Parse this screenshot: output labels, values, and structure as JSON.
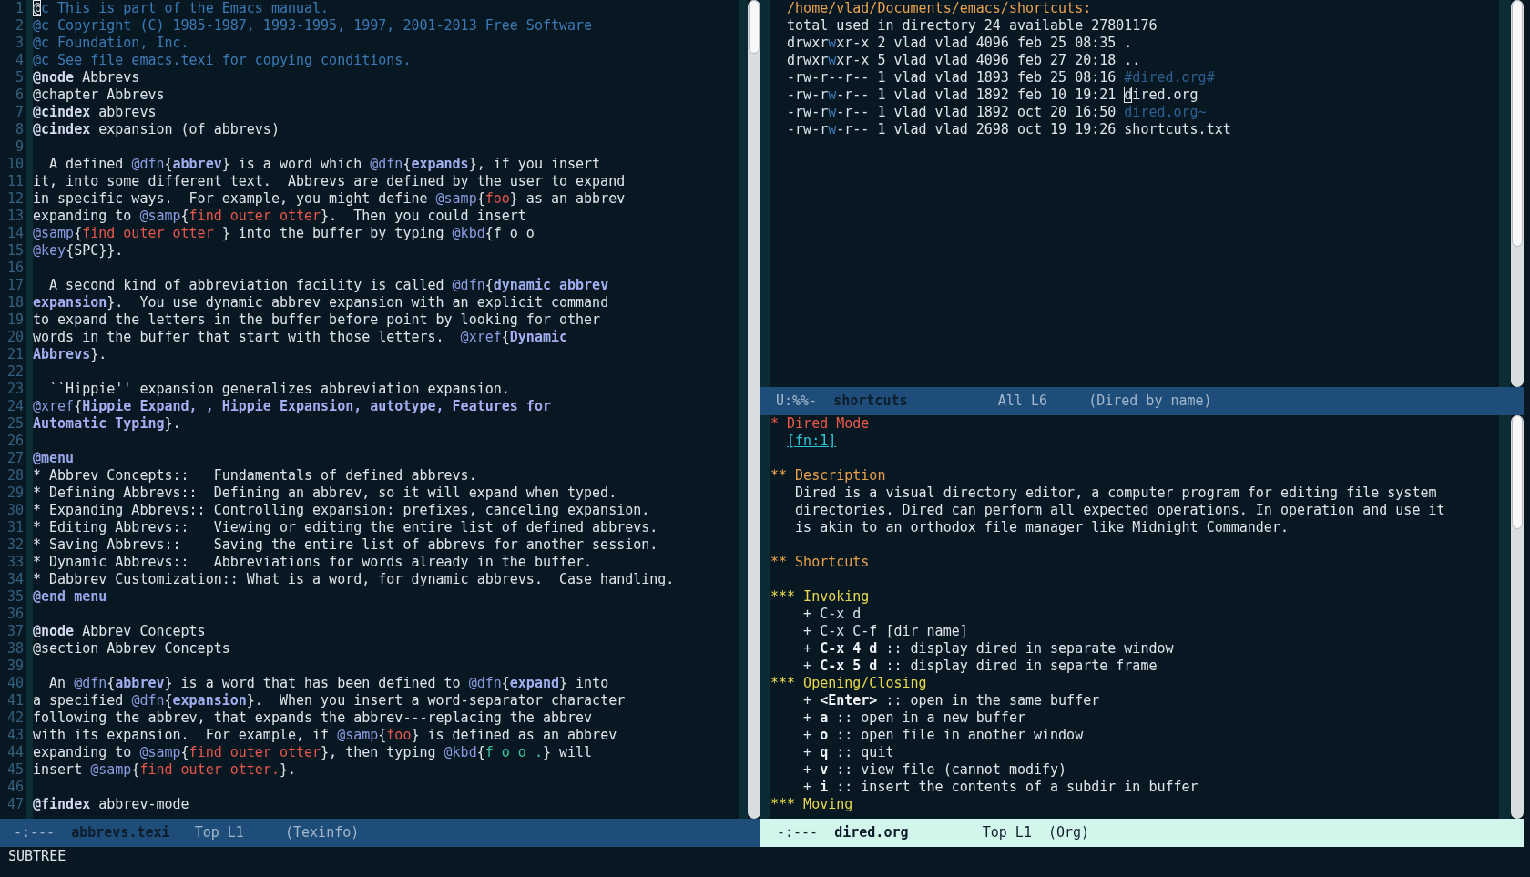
{
  "windows": [
    {
      "kind": "texinfo",
      "lines": [
        {
          "number": "1",
          "spans": [
            {
              "kind": "cursor",
              "text": "@"
            },
            {
              "kind": "comment",
              "text": "c This is part of the Emacs manual."
            }
          ]
        },
        {
          "number": "2",
          "spans": [
            {
              "kind": "comment",
              "text": "@c Copyright (C) 1985-1987, 1993-1995, 1997, 2001-2013 Free Software"
            }
          ]
        },
        {
          "number": "3",
          "spans": [
            {
              "kind": "comment",
              "text": "@c Foundation, Inc."
            }
          ]
        },
        {
          "number": "4",
          "spans": [
            {
              "kind": "comment",
              "text": "@c See file emacs.texi for copying conditions."
            }
          ]
        },
        {
          "number": "5",
          "spans": [
            {
              "kind": "keyword",
              "text": "@node"
            },
            {
              "kind": "text",
              "text": " Abbrevs"
            }
          ]
        },
        {
          "number": "6",
          "text": "@chapter Abbrevs"
        },
        {
          "number": "7",
          "spans": [
            {
              "kind": "keyword",
              "text": "@cindex"
            },
            {
              "kind": "text",
              "text": " abbrevs"
            }
          ]
        },
        {
          "number": "8",
          "spans": [
            {
              "kind": "keyword",
              "text": "@cindex"
            },
            {
              "kind": "text",
              "text": " expansion (of abbrevs)"
            }
          ]
        },
        {
          "number": "9"
        },
        {
          "number": "10",
          "spans": [
            {
              "kind": "text",
              "text": "  A defined "
            },
            {
              "kind": "command",
              "text": "@dfn"
            },
            {
              "kind": "text",
              "text": "{"
            },
            {
              "kind": "dfn",
              "text": "abbrev"
            },
            {
              "kind": "text",
              "text": "} is a word which "
            },
            {
              "kind": "command",
              "text": "@dfn"
            },
            {
              "kind": "text",
              "text": "{"
            },
            {
              "kind": "dfn",
              "text": "expands"
            },
            {
              "kind": "text",
              "text": "}, if you insert"
            }
          ]
        },
        {
          "number": "11",
          "text": "it, into some different text.  Abbrevs are defined by the user to expand"
        },
        {
          "number": "12",
          "spans": [
            {
              "kind": "text",
              "text": "in specific ways.  For example, you might define "
            },
            {
              "kind": "command",
              "text": "@samp"
            },
            {
              "kind": "text",
              "text": "{"
            },
            {
              "kind": "samp",
              "text": "foo"
            },
            {
              "kind": "text",
              "text": "} as an abbrev"
            }
          ]
        },
        {
          "number": "13",
          "spans": [
            {
              "kind": "text",
              "text": "expanding to "
            },
            {
              "kind": "command",
              "text": "@samp"
            },
            {
              "kind": "text",
              "text": "{"
            },
            {
              "kind": "samp",
              "text": "find outer otter"
            },
            {
              "kind": "text",
              "text": "}.  Then you could insert"
            }
          ]
        },
        {
          "number": "14",
          "spans": [
            {
              "kind": "command",
              "text": "@samp"
            },
            {
              "kind": "text",
              "text": "{"
            },
            {
              "kind": "samp",
              "text": "find outer otter "
            },
            {
              "kind": "text",
              "text": "} into the buffer by typing "
            },
            {
              "kind": "command",
              "text": "@kbd"
            },
            {
              "kind": "text",
              "text": "{f o o"
            }
          ]
        },
        {
          "number": "15",
          "spans": [
            {
              "kind": "command",
              "text": "@key"
            },
            {
              "kind": "text",
              "text": "{SPC}}."
            }
          ]
        },
        {
          "number": "16"
        },
        {
          "number": "17",
          "spans": [
            {
              "kind": "text",
              "text": "  A second kind of abbreviation facility is called "
            },
            {
              "kind": "command",
              "text": "@dfn"
            },
            {
              "kind": "text",
              "text": "{"
            },
            {
              "kind": "dfn",
              "text": "dynamic abbrev"
            }
          ]
        },
        {
          "number": "18",
          "spans": [
            {
              "kind": "dfn",
              "text": "expansion"
            },
            {
              "kind": "text",
              "text": "}.  You use dynamic abbrev expansion with an explicit command"
            }
          ]
        },
        {
          "number": "19",
          "text": "to expand the letters in the buffer before point by looking for other"
        },
        {
          "number": "20",
          "spans": [
            {
              "kind": "text",
              "text": "words in the buffer that start with those letters.  "
            },
            {
              "kind": "command",
              "text": "@xref"
            },
            {
              "kind": "text",
              "text": "{"
            },
            {
              "kind": "dfn",
              "text": "Dynamic"
            }
          ]
        },
        {
          "number": "21",
          "spans": [
            {
              "kind": "dfn",
              "text": "Abbrevs"
            },
            {
              "kind": "text",
              "text": "}."
            }
          ]
        },
        {
          "number": "22"
        },
        {
          "number": "23",
          "text": "  ``Hippie'' expansion generalizes abbreviation expansion."
        },
        {
          "number": "24",
          "spans": [
            {
              "kind": "command",
              "text": "@xref"
            },
            {
              "kind": "text",
              "text": "{"
            },
            {
              "kind": "dfn",
              "text": "Hippie Expand, , Hippie Expansion, autotype, Features for"
            }
          ]
        },
        {
          "number": "25",
          "spans": [
            {
              "kind": "dfn",
              "text": "Automatic Typing"
            },
            {
              "kind": "text",
              "text": "}."
            }
          ]
        },
        {
          "number": "26"
        },
        {
          "number": "27",
          "spans": [
            {
              "kind": "block",
              "text": "@menu"
            }
          ]
        },
        {
          "number": "28",
          "text": "* Abbrev Concepts::   Fundamentals of defined abbrevs."
        },
        {
          "number": "29",
          "text": "* Defining Abbrevs::  Defining an abbrev, so it will expand when typed."
        },
        {
          "number": "30",
          "text": "* Expanding Abbrevs:: Controlling expansion: prefixes, canceling expansion."
        },
        {
          "number": "31",
          "text": "* Editing Abbrevs::   Viewing or editing the entire list of defined abbrevs."
        },
        {
          "number": "32",
          "text": "* Saving Abbrevs::    Saving the entire list of abbrevs for another session."
        },
        {
          "number": "33",
          "text": "* Dynamic Abbrevs::   Abbreviations for words already in the buffer."
        },
        {
          "number": "34",
          "text": "* Dabbrev Customization:: What is a word, for dynamic abbrevs.  Case handling."
        },
        {
          "number": "35",
          "spans": [
            {
              "kind": "block",
              "text": "@end menu"
            }
          ]
        },
        {
          "number": "36"
        },
        {
          "number": "37",
          "spans": [
            {
              "kind": "keyword",
              "text": "@node"
            },
            {
              "kind": "text",
              "text": " Abbrev Concepts"
            }
          ]
        },
        {
          "number": "38",
          "text": "@section Abbrev Concepts"
        },
        {
          "number": "39"
        },
        {
          "number": "40",
          "spans": [
            {
              "kind": "text",
              "text": "  An "
            },
            {
              "kind": "command",
              "text": "@dfn"
            },
            {
              "kind": "text",
              "text": "{"
            },
            {
              "kind": "dfn",
              "text": "abbrev"
            },
            {
              "kind": "text",
              "text": "} is a word that has been defined to "
            },
            {
              "kind": "command",
              "text": "@dfn"
            },
            {
              "kind": "text",
              "text": "{"
            },
            {
              "kind": "dfn",
              "text": "expand"
            },
            {
              "kind": "text",
              "text": "} into"
            }
          ]
        },
        {
          "number": "41",
          "spans": [
            {
              "kind": "text",
              "text": "a specified "
            },
            {
              "kind": "command",
              "text": "@dfn"
            },
            {
              "kind": "text",
              "text": "{"
            },
            {
              "kind": "dfn",
              "text": "expansion"
            },
            {
              "kind": "text",
              "text": "}.  When you insert a word-separator character"
            }
          ]
        },
        {
          "number": "42",
          "text": "following the abbrev, that expands the abbrev---replacing the abbrev"
        },
        {
          "number": "43",
          "spans": [
            {
              "kind": "text",
              "text": "with its expansion.  For example, if "
            },
            {
              "kind": "command",
              "text": "@samp"
            },
            {
              "kind": "text",
              "text": "{"
            },
            {
              "kind": "samp",
              "text": "foo"
            },
            {
              "kind": "text",
              "text": "} is defined as an abbrev"
            }
          ]
        },
        {
          "number": "44",
          "spans": [
            {
              "kind": "text",
              "text": "expanding to "
            },
            {
              "kind": "command",
              "text": "@samp"
            },
            {
              "kind": "text",
              "text": "{"
            },
            {
              "kind": "samp",
              "text": "find outer otter"
            },
            {
              "kind": "text",
              "text": "}, then typing "
            },
            {
              "kind": "command",
              "text": "@kbd"
            },
            {
              "kind": "text",
              "text": "{"
            },
            {
              "kind": "kbd",
              "text": "f o o ."
            },
            {
              "kind": "text",
              "text": "} will"
            }
          ]
        },
        {
          "number": "45",
          "spans": [
            {
              "kind": "text",
              "text": "insert "
            },
            {
              "kind": "command",
              "text": "@samp"
            },
            {
              "kind": "text",
              "text": "{"
            },
            {
              "kind": "samp",
              "text": "find outer otter."
            },
            {
              "kind": "text",
              "text": "}."
            }
          ]
        },
        {
          "number": "46"
        },
        {
          "number": "47",
          "spans": [
            {
              "kind": "keyword",
              "text": "@findex"
            },
            {
              "kind": "text",
              "text": " abbrev-mode"
            }
          ]
        }
      ],
      "mode_line": {
        "active": false,
        "flags": "-:---",
        "buffer": "abbrevs.texi",
        "position": "Top L1",
        "mode": "(Texinfo)"
      }
    },
    {
      "kind": "dired",
      "lines": [
        {
          "spans": [
            {
              "kind": "header",
              "text": "  /home/vlad/Documents/emacs/shortcuts:"
            }
          ]
        },
        {
          "text": "  total used in directory 24 available 27801176"
        },
        {
          "spans": [
            {
              "kind": "text",
              "text": "  drwxr"
            },
            {
              "kind": "perm",
              "text": "w"
            },
            {
              "kind": "text",
              "text": "xr-x 2 vlad vlad 4096 feb 25 08:35 ."
            }
          ]
        },
        {
          "spans": [
            {
              "kind": "text",
              "text": "  drwxr"
            },
            {
              "kind": "perm",
              "text": "w"
            },
            {
              "kind": "text",
              "text": "xr-x 5 vlad vlad 4096 feb 27 20:18 .."
            }
          ]
        },
        {
          "spans": [
            {
              "kind": "text",
              "text": "  -rw-r--r-- 1 vlad vlad 1893 feb 25 08:16 "
            },
            {
              "kind": "backup",
              "text": "#dired.org#"
            }
          ]
        },
        {
          "spans": [
            {
              "kind": "text",
              "text": "  -rw-r"
            },
            {
              "kind": "perm",
              "text": "w"
            },
            {
              "kind": "text",
              "text": "-r-- 1 vlad vlad 1892 feb 10 19:21 "
            },
            {
              "kind": "cursor",
              "text": "d"
            },
            {
              "kind": "text",
              "text": "ired.org"
            }
          ]
        },
        {
          "spans": [
            {
              "kind": "text",
              "text": "  -rw-r"
            },
            {
              "kind": "perm",
              "text": "w"
            },
            {
              "kind": "text",
              "text": "-r-- 1 vlad vlad 1892 oct 20 16:50 "
            },
            {
              "kind": "backup",
              "text": "dired.org~"
            }
          ]
        },
        {
          "spans": [
            {
              "kind": "text",
              "text": "  -rw-r"
            },
            {
              "kind": "perm",
              "text": "w"
            },
            {
              "kind": "text",
              "text": "-r-- 1 vlad vlad 2698 oct 19 19:26 shortcuts.txt"
            }
          ]
        }
      ],
      "mode_line": {
        "active": false,
        "flags": "U:%%-",
        "buffer": "shortcuts",
        "position": "All L6",
        "mode": "(Dired by name)"
      }
    },
    {
      "kind": "org",
      "blocks": [
        [
          {
            "spans": [
              {
                "kind": "h1",
                "text": "* Dired Mode"
              }
            ]
          },
          {
            "spans": [
              {
                "kind": "link",
                "text": "[fn:1]"
              }
            ]
          }
        ],
        [
          {
            "spans": [
              {
                "kind": "h2",
                "text": "** Description"
              }
            ]
          },
          {
            "text": "   Dired is a visual directory editor, a computer program for editing file system"
          },
          {
            "text": "   directories. Dired can perform all expected operations. In operation and use it"
          },
          {
            "text": "   is akin to an orthodox file manager like Midnight Commander."
          }
        ],
        [
          {
            "spans": [
              {
                "kind": "h2",
                "text": "** Shortcuts"
              }
            ]
          }
        ],
        [
          {
            "spans": [
              {
                "kind": "h3",
                "text": "*** Invoking"
              }
            ]
          },
          {
            "text": "    + C-x d"
          },
          {
            "text": "    + C-x C-f [dir name]"
          },
          {
            "spans": [
              {
                "kind": "text",
                "text": "    + "
              },
              {
                "kind": "bold",
                "text": "C-x 4 d"
              },
              {
                "kind": "text",
                "text": " :: display dired in separate window"
              }
            ]
          },
          {
            "spans": [
              {
                "kind": "text",
                "text": "    + "
              },
              {
                "kind": "bold",
                "text": "C-x 5 d"
              },
              {
                "kind": "text",
                "text": " :: display dired in separte frame"
              }
            ]
          },
          {
            "spans": [
              {
                "kind": "h3",
                "text": "*** Opening/Closing"
              }
            ]
          },
          {
            "spans": [
              {
                "kind": "text",
                "text": "    + "
              },
              {
                "kind": "bold",
                "text": "<Enter>"
              },
              {
                "kind": "text",
                "text": " :: open in the same buffer"
              }
            ]
          },
          {
            "spans": [
              {
                "kind": "text",
                "text": "    + "
              },
              {
                "kind": "bold",
                "text": "a"
              },
              {
                "kind": "text",
                "text": " :: open in a new buffer"
              }
            ]
          },
          {
            "spans": [
              {
                "kind": "text",
                "text": "    + "
              },
              {
                "kind": "bold",
                "text": "o"
              },
              {
                "kind": "text",
                "text": " :: open file in another window"
              }
            ]
          },
          {
            "spans": [
              {
                "kind": "text",
                "text": "    + "
              },
              {
                "kind": "bold",
                "text": "q"
              },
              {
                "kind": "text",
                "text": " :: quit"
              }
            ]
          },
          {
            "spans": [
              {
                "kind": "text",
                "text": "    + "
              },
              {
                "kind": "bold",
                "text": "v"
              },
              {
                "kind": "text",
                "text": " :: view file (cannot modify)"
              }
            ]
          },
          {
            "spans": [
              {
                "kind": "text",
                "text": "    + "
              },
              {
                "kind": "bold",
                "text": "i"
              },
              {
                "kind": "text",
                "text": " :: insert the contents of a subdir in buffer"
              }
            ]
          },
          {
            "spans": [
              {
                "kind": "h3",
                "text": "*** Moving"
              }
            ]
          }
        ]
      ],
      "mode_line": {
        "active": true,
        "flags": "-:---",
        "buffer": "dired.org",
        "position": "Top L1",
        "mode": "(Org)"
      }
    }
  ],
  "echo_area": {
    "message": "SUBTREE"
  }
}
